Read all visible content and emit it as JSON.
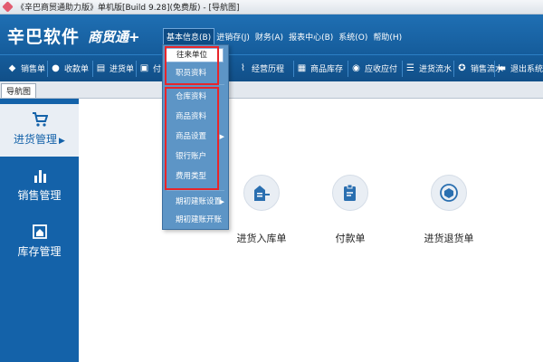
{
  "window": {
    "title": "《辛巴商贸通助力版》单机版[Build 9.28](免费版) - [导航图]"
  },
  "header": {
    "logo": "辛巴软件",
    "logo_sub": "商贸通+",
    "menu": [
      "基本信息(B)",
      "进销存(J)",
      "财务(A)",
      "报表中心(B)",
      "系统(O)",
      "帮助(H)"
    ]
  },
  "toolbar": {
    "left": [
      "销售单",
      "收款单",
      "进货单",
      "付"
    ],
    "right": [
      "经营历程",
      "商品库存",
      "应收应付",
      "进货流水",
      "销售流水",
      "退出系统"
    ]
  },
  "tabstrip": {
    "tab": "导航图"
  },
  "sidebar": {
    "items": [
      "进货管理",
      "销售管理",
      "库存管理"
    ]
  },
  "main": {
    "actions": [
      "进货入库单",
      "付款单",
      "进货退货单"
    ]
  },
  "dropdown": {
    "items": [
      "往来单位",
      "职员资料",
      "仓库资料",
      "商品资料",
      "商品设置",
      "银行账户",
      "费用类型",
      "期初建账设置",
      "期初建账开账"
    ]
  },
  "colors": {
    "primary_blue": "#1462a9",
    "highlight_red": "#e8252a"
  }
}
